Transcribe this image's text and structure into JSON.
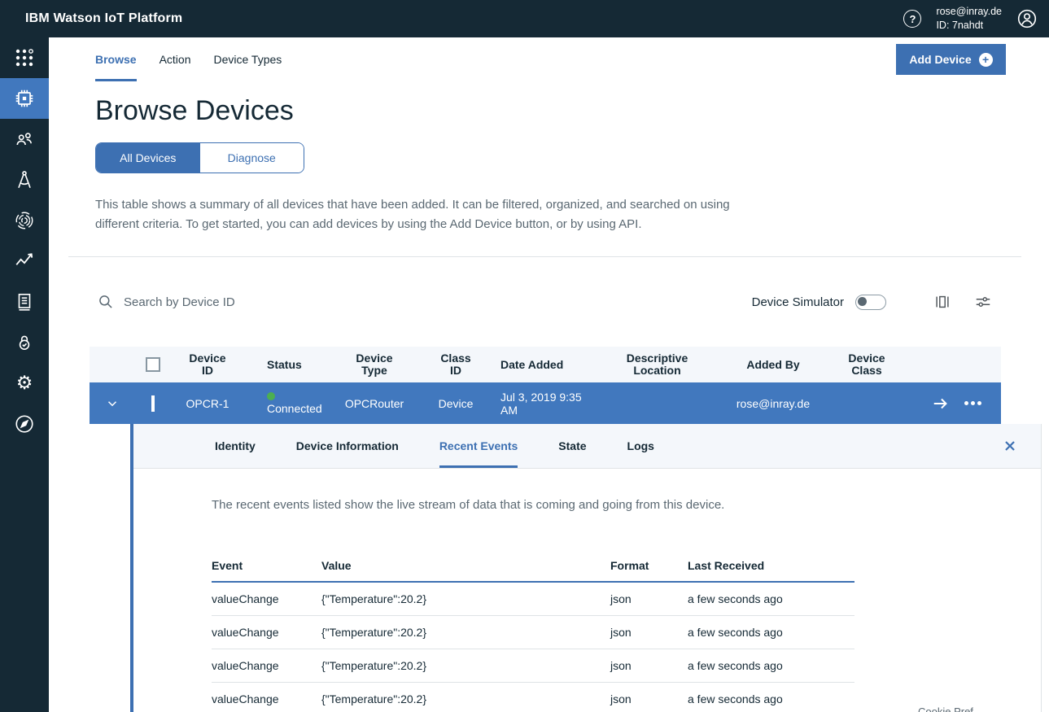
{
  "topbar": {
    "title": "IBM Watson IoT Platform",
    "help_label": "?",
    "user_email": "rose@inray.de",
    "user_id": "ID: 7nahdt"
  },
  "sidebar": {
    "items": [
      {
        "icon": "app-switcher-icon",
        "active": false
      },
      {
        "icon": "devices-chip-icon",
        "active": true
      },
      {
        "icon": "members-icon",
        "active": false
      },
      {
        "icon": "schemas-compass-icon",
        "active": false
      },
      {
        "icon": "fingerprint-icon",
        "active": false
      },
      {
        "icon": "usage-chart-icon",
        "active": false
      },
      {
        "icon": "docs-icon",
        "active": false
      },
      {
        "icon": "security-lock-icon",
        "active": false
      },
      {
        "icon": "settings-gear-icon",
        "active": false
      },
      {
        "icon": "explore-compass-icon",
        "active": false
      }
    ],
    "gear_glyph": "⚙"
  },
  "nav": {
    "tabs": [
      "Browse",
      "Action",
      "Device Types"
    ],
    "active_tab": "Browse",
    "add_device_label": "Add Device",
    "plus_glyph": "+"
  },
  "page": {
    "title": "Browse Devices",
    "switcher": [
      "All Devices",
      "Diagnose"
    ],
    "active_switch": "All Devices",
    "description": "This table shows a summary of all devices that have been added. It can be filtered, organized, and searched on using different criteria. To get started, you can add devices by using the Add Device button, or by using API."
  },
  "toolbar": {
    "search_placeholder": "Search by Device ID",
    "device_simulator_label": "Device Simulator",
    "device_simulator_on": false
  },
  "device_table": {
    "columns": [
      "Device ID",
      "Status",
      "Device Type",
      "Class ID",
      "Date Added",
      "Descriptive Location",
      "Added By",
      "Device Class"
    ],
    "row": {
      "device_id": "OPCR-1",
      "status": "Connected",
      "status_connected": true,
      "device_type": "OPCRouter",
      "class_id": "Device",
      "date_added": "Jul 3, 2019 9:35 AM",
      "descriptive_location": "",
      "added_by": "rose@inray.de",
      "device_class": "",
      "selected": true
    }
  },
  "detail_panel": {
    "tabs": [
      "Identity",
      "Device Information",
      "Recent Events",
      "State",
      "Logs"
    ],
    "active_tab": "Recent Events",
    "description": "The recent events listed show the live stream of data that is coming and going from this device.",
    "events_table": {
      "columns": [
        "Event",
        "Value",
        "Format",
        "Last Received"
      ],
      "rows": [
        {
          "event": "valueChange",
          "value": "{\"Temperature\":20.2}",
          "format": "json",
          "last_received": "a few seconds ago"
        },
        {
          "event": "valueChange",
          "value": "{\"Temperature\":20.2}",
          "format": "json",
          "last_received": "a few seconds ago"
        },
        {
          "event": "valueChange",
          "value": "{\"Temperature\":20.2}",
          "format": "json",
          "last_received": "a few seconds ago"
        },
        {
          "event": "valueChange",
          "value": "{\"Temperature\":20.2}",
          "format": "json",
          "last_received": "a few seconds ago"
        }
      ]
    }
  },
  "footer": {
    "cookie_label": "Cookie Pref"
  },
  "colors": {
    "topbar_bg": "#152935",
    "accent_blue": "#3D70B2",
    "selected_row_blue": "#4178BE",
    "header_bg": "#f4f7fb",
    "status_green": "#4caf50",
    "text_gray": "#5A6872",
    "border_gray": "#dfe3e6"
  }
}
